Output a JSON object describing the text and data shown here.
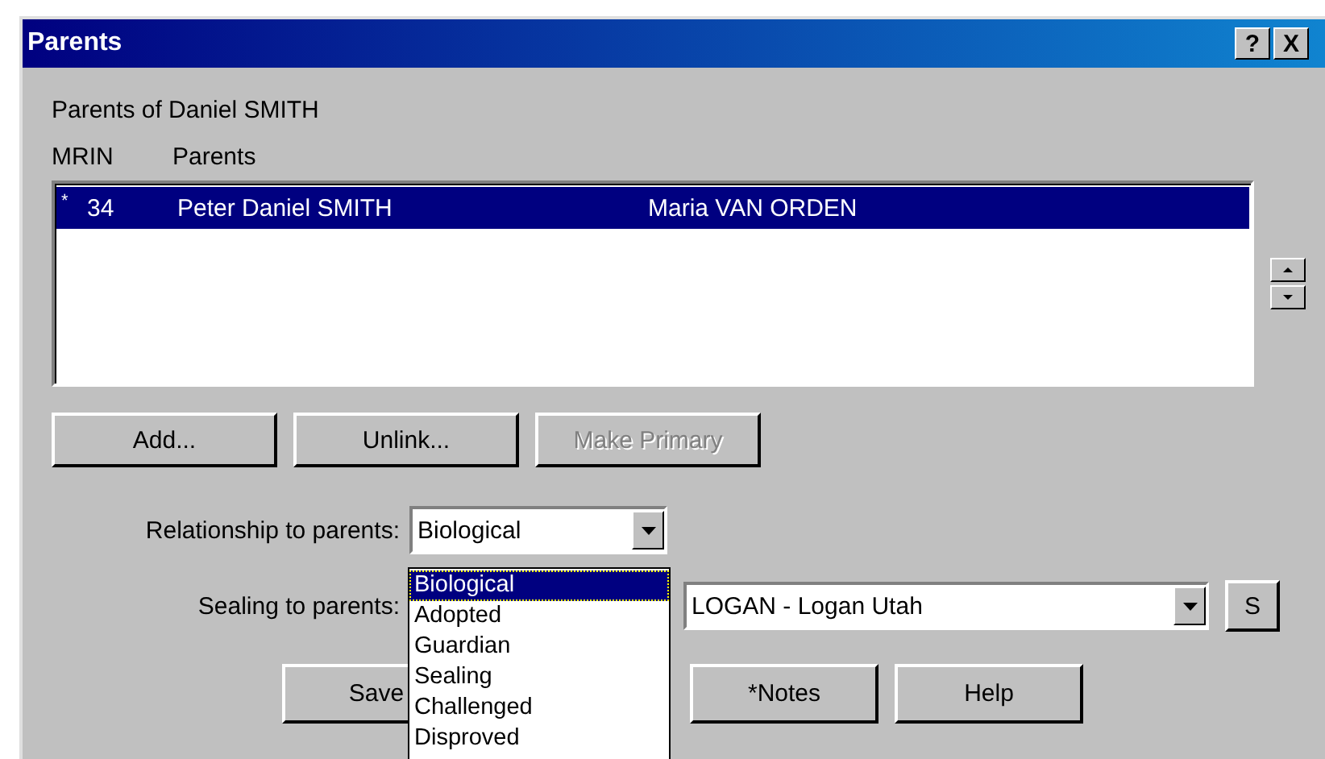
{
  "window": {
    "title": "Parents",
    "title_buttons": [
      "?",
      "X"
    ]
  },
  "heading": "Parents of Daniel SMITH",
  "list": {
    "columns": [
      "MRIN",
      "Parents"
    ],
    "rows": [
      {
        "mark": "*",
        "mrin": "34",
        "father": "Peter Daniel SMITH",
        "mother": "Maria VAN ORDEN",
        "selected": true
      }
    ]
  },
  "buttons": [
    {
      "label": "Add...",
      "disabled": false
    },
    {
      "label": "Unlink...",
      "disabled": false
    },
    {
      "label": "Make Primary",
      "disabled": true
    }
  ],
  "relationship": {
    "label": "Relationship to parents:",
    "value": "Biological",
    "expanded": true,
    "options": [
      {
        "label": "Biological",
        "selected": true
      },
      {
        "label": "Adopted",
        "selected": false
      },
      {
        "label": "Guardian",
        "selected": false
      },
      {
        "label": "Sealing",
        "selected": false
      },
      {
        "label": "Challenged",
        "selected": false
      },
      {
        "label": "Disproved",
        "selected": false
      }
    ]
  },
  "sealing": {
    "label": "Sealing to parents:",
    "temple": "LOGAN - Logan Utah",
    "button": "S"
  },
  "footer_buttons": [
    {
      "label": "Save"
    },
    {
      "label": "*Notes"
    },
    {
      "label": "Help"
    }
  ]
}
